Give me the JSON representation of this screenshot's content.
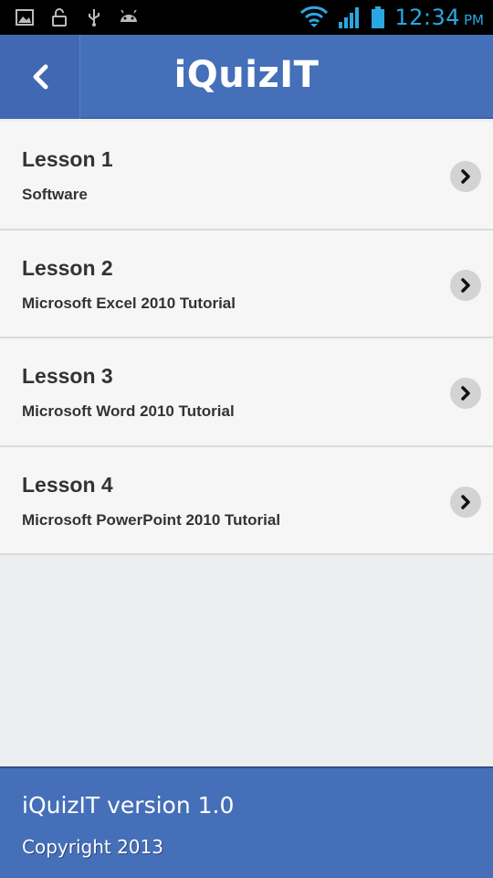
{
  "status_bar": {
    "left_icons": [
      "image-icon",
      "lock-icon",
      "usb-icon",
      "android-icon"
    ],
    "right_icons": [
      "wifi-icon",
      "signal-icon",
      "battery-icon"
    ],
    "time": "12:34",
    "ampm": "PM",
    "color": "#2aa7e0"
  },
  "header": {
    "title": "iQuizIT",
    "back_icon": "chevron-left-icon",
    "color": "#456fb8"
  },
  "lessons": [
    {
      "title": "Lesson 1",
      "subtitle": "Software"
    },
    {
      "title": "Lesson 2",
      "subtitle": "Microsoft Excel 2010 Tutorial"
    },
    {
      "title": "Lesson 3",
      "subtitle": "Microsoft Word 2010 Tutorial"
    },
    {
      "title": "Lesson 4",
      "subtitle": "Microsoft PowerPoint 2010 Tutorial"
    }
  ],
  "footer": {
    "version": "iQuizIT version 1.0",
    "copyright": "Copyright 2013"
  }
}
